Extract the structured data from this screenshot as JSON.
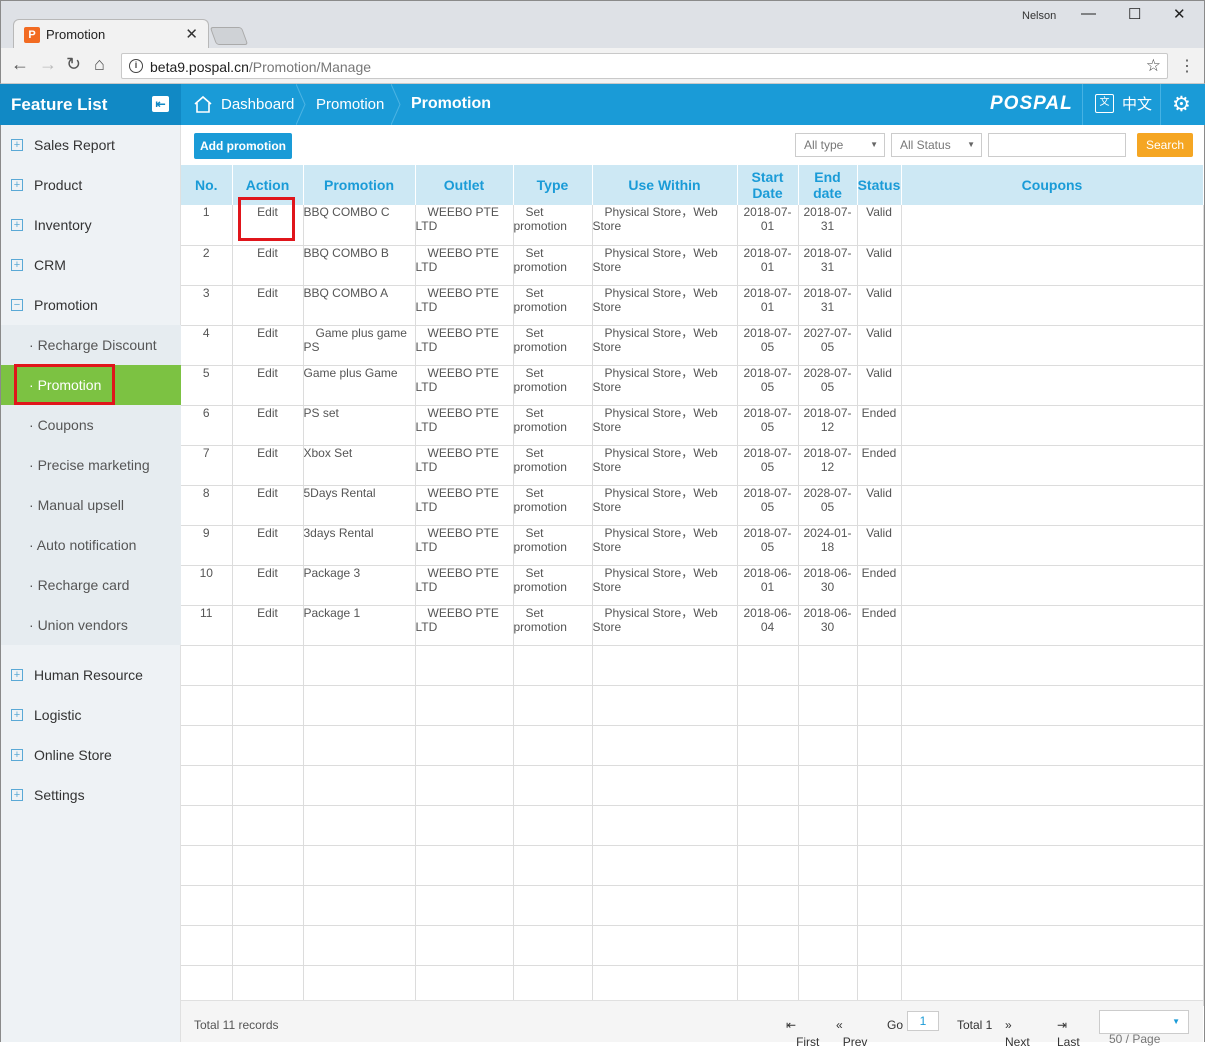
{
  "browser": {
    "tab_title": "Promotion",
    "user": "Nelson",
    "url_host": "beta9.pospal.cn",
    "url_path": "/Promotion/Manage"
  },
  "header": {
    "feature_list": "Feature List",
    "crumbs": [
      "Dashboard",
      "Promotion",
      "Promotion"
    ],
    "brand": "POSPAL",
    "lang": "中文"
  },
  "sidebar": {
    "items": [
      {
        "sign": "+",
        "label": "Sales Report"
      },
      {
        "sign": "+",
        "label": "Product"
      },
      {
        "sign": "+",
        "label": "Inventory"
      },
      {
        "sign": "+",
        "label": "CRM"
      },
      {
        "sign": "−",
        "label": "Promotion"
      }
    ],
    "sub": [
      "Recharge Discount",
      "Promotion",
      "Coupons",
      "Precise marketing",
      "Manual upsell",
      "Auto notification",
      "Recharge card",
      "Union vendors"
    ],
    "bottom": [
      {
        "sign": "+",
        "label": "Human Resource"
      },
      {
        "sign": "+",
        "label": "Logistic"
      },
      {
        "sign": "+",
        "label": "Online Store"
      },
      {
        "sign": "+",
        "label": "Settings"
      }
    ]
  },
  "toolbar": {
    "add": "Add promotion",
    "type_filter": "All type",
    "status_filter": "All Status",
    "search": "Search"
  },
  "table": {
    "headers": [
      "No.",
      "Action",
      "Promotion",
      "Outlet",
      "Type",
      "Use Within",
      "Start Date",
      "End date",
      "Status",
      "Coupons"
    ],
    "rows": [
      {
        "no": "1",
        "action": "Edit",
        "promotion": "BBQ COMBO C",
        "outlet_a": "WEEBO PTE",
        "outlet_b": "LTD",
        "type_a": "Set",
        "type_b": "promotion",
        "use_a": "Physical Store，Web",
        "use_b": "Store",
        "start_a": "2018-07-",
        "start_b": "01",
        "end_a": "2018-07-",
        "end_b": "31",
        "status": "Valid"
      },
      {
        "no": "2",
        "action": "Edit",
        "promotion": "BBQ COMBO B",
        "outlet_a": "WEEBO PTE",
        "outlet_b": "LTD",
        "type_a": "Set",
        "type_b": "promotion",
        "use_a": "Physical Store，Web",
        "use_b": "Store",
        "start_a": "2018-07-",
        "start_b": "01",
        "end_a": "2018-07-",
        "end_b": "31",
        "status": "Valid"
      },
      {
        "no": "3",
        "action": "Edit",
        "promotion": "BBQ COMBO A",
        "outlet_a": "WEEBO PTE",
        "outlet_b": "LTD",
        "type_a": "Set",
        "type_b": "promotion",
        "use_a": "Physical Store，Web",
        "use_b": "Store",
        "start_a": "2018-07-",
        "start_b": "01",
        "end_a": "2018-07-",
        "end_b": "31",
        "status": "Valid"
      },
      {
        "no": "4",
        "action": "Edit",
        "promotion": "Game plus game",
        "promotion_b": "PS",
        "outlet_a": "WEEBO PTE",
        "outlet_b": "LTD",
        "type_a": "Set",
        "type_b": "promotion",
        "use_a": "Physical Store，Web",
        "use_b": "Store",
        "start_a": "2018-07-",
        "start_b": "05",
        "end_a": "2027-07-",
        "end_b": "05",
        "status": "Valid"
      },
      {
        "no": "5",
        "action": "Edit",
        "promotion": "Game plus Game",
        "outlet_a": "WEEBO PTE",
        "outlet_b": "LTD",
        "type_a": "Set",
        "type_b": "promotion",
        "use_a": "Physical Store，Web",
        "use_b": "Store",
        "start_a": "2018-07-",
        "start_b": "05",
        "end_a": "2028-07-",
        "end_b": "05",
        "status": "Valid"
      },
      {
        "no": "6",
        "action": "Edit",
        "promotion": "PS set",
        "outlet_a": "WEEBO PTE",
        "outlet_b": "LTD",
        "type_a": "Set",
        "type_b": "promotion",
        "use_a": "Physical Store，Web",
        "use_b": "Store",
        "start_a": "2018-07-",
        "start_b": "05",
        "end_a": "2018-07-",
        "end_b": "12",
        "status": "Ended"
      },
      {
        "no": "7",
        "action": "Edit",
        "promotion": "Xbox Set",
        "outlet_a": "WEEBO PTE",
        "outlet_b": "LTD",
        "type_a": "Set",
        "type_b": "promotion",
        "use_a": "Physical Store，Web",
        "use_b": "Store",
        "start_a": "2018-07-",
        "start_b": "05",
        "end_a": "2018-07-",
        "end_b": "12",
        "status": "Ended"
      },
      {
        "no": "8",
        "action": "Edit",
        "promotion": "5Days Rental",
        "outlet_a": "WEEBO PTE",
        "outlet_b": "LTD",
        "type_a": "Set",
        "type_b": "promotion",
        "use_a": "Physical Store，Web",
        "use_b": "Store",
        "start_a": "2018-07-",
        "start_b": "05",
        "end_a": "2028-07-",
        "end_b": "05",
        "status": "Valid"
      },
      {
        "no": "9",
        "action": "Edit",
        "promotion": "3days Rental",
        "outlet_a": "WEEBO PTE",
        "outlet_b": "LTD",
        "type_a": "Set",
        "type_b": "promotion",
        "use_a": "Physical Store，Web",
        "use_b": "Store",
        "start_a": "2018-07-",
        "start_b": "05",
        "end_a": "2024-01-",
        "end_b": "18",
        "status": "Valid"
      },
      {
        "no": "10",
        "action": "Edit",
        "promotion": "Package 3",
        "outlet_a": "WEEBO PTE",
        "outlet_b": "LTD",
        "type_a": "Set",
        "type_b": "promotion",
        "use_a": "Physical Store，Web",
        "use_b": "Store",
        "start_a": "2018-06-",
        "start_b": "01",
        "end_a": "2018-06-",
        "end_b": "30",
        "status": "Ended"
      },
      {
        "no": "11",
        "action": "Edit",
        "promotion": "Package 1",
        "outlet_a": "WEEBO PTE",
        "outlet_b": "LTD",
        "type_a": "Set",
        "type_b": "promotion",
        "use_a": "Physical Store，Web",
        "use_b": "Store",
        "start_a": "2018-06-",
        "start_b": "04",
        "end_a": "2018-06-",
        "end_b": "30",
        "status": "Ended"
      }
    ]
  },
  "footer": {
    "total_records": "Total 11 records",
    "first": "First",
    "prev": "Prev",
    "go": "Go",
    "page": "1",
    "total_pages": "Total 1",
    "next": "Next",
    "last": "Last",
    "page_size": "50 / Page"
  },
  "colors": {
    "accent": "#1a9bd7",
    "active_green": "#7cc242",
    "ended_red": "#e03a3a",
    "search_orange": "#f5a623",
    "highlight": "#e0151b"
  }
}
